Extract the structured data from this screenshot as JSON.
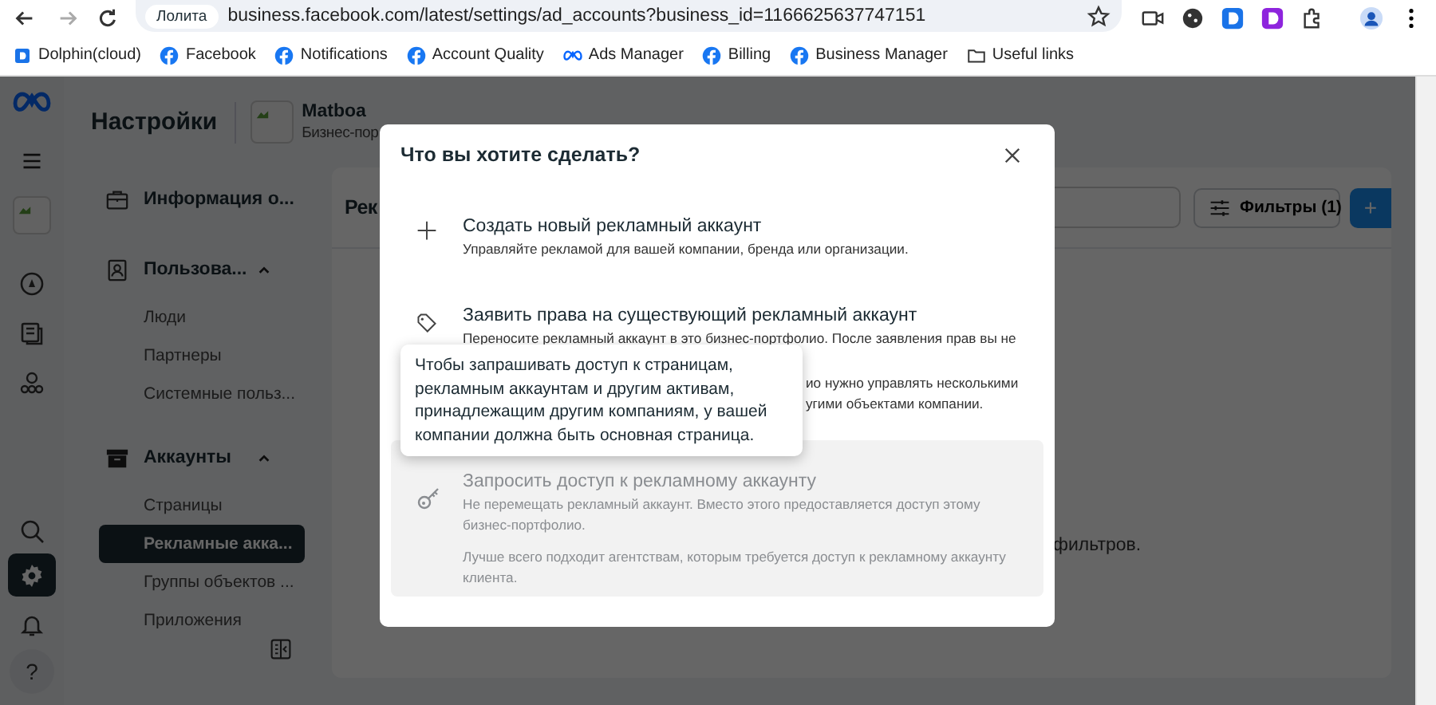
{
  "browser": {
    "site_chip": "Лолита",
    "url": "business.facebook.com/latest/settings/ad_accounts?business_id=1166625637747151",
    "bookmarks": [
      {
        "kind": "dolphin",
        "label": "Dolphin(cloud)"
      },
      {
        "kind": "fb",
        "label": "Facebook"
      },
      {
        "kind": "fb",
        "label": "Notifications"
      },
      {
        "kind": "fb",
        "label": "Account Quality"
      },
      {
        "kind": "meta",
        "label": "Ads Manager"
      },
      {
        "kind": "fb",
        "label": "Billing"
      },
      {
        "kind": "fb",
        "label": "Business Manager"
      },
      {
        "kind": "folder",
        "label": "Useful links"
      }
    ]
  },
  "rail": [
    {
      "kind": "logo",
      "selected": false
    },
    {
      "kind": "menu",
      "selected": false
    },
    {
      "kind": "business",
      "selected": false
    },
    {
      "kind": "compass",
      "selected": false
    },
    {
      "kind": "pages",
      "selected": false
    },
    {
      "kind": "groups",
      "selected": false
    },
    {
      "kind": "search",
      "selected": false
    },
    {
      "kind": "settings",
      "selected": true
    },
    {
      "kind": "bell",
      "selected": false
    },
    {
      "kind": "help",
      "selected": false,
      "label": "?"
    }
  ],
  "header": {
    "title": "Настройки",
    "business_name": "Matboa",
    "business_subtitle": "Бизнес-пор"
  },
  "sidebar": {
    "sections": [
      {
        "kind": "info",
        "label": "Информация о..."
      },
      {
        "kind": "people",
        "label": "Пользова...",
        "expanded": true,
        "children": [
          {
            "label": "Люди",
            "selected": false
          },
          {
            "label": "Партнеры",
            "selected": false
          },
          {
            "label": "Системные польз...",
            "selected": false
          }
        ]
      },
      {
        "kind": "accounts",
        "label": "Аккаунты",
        "expanded": true,
        "children": [
          {
            "label": "Страницы",
            "selected": false
          },
          {
            "label": "Рекламные акка...",
            "selected": true
          },
          {
            "label": "Группы объектов ...",
            "selected": false
          },
          {
            "label": "Приложения",
            "selected": false
          }
        ]
      }
    ]
  },
  "content": {
    "title": "Рек",
    "filter_button": "Фильтры (1)",
    "add_button": "+",
    "empty_text": "фильтров."
  },
  "modal": {
    "title": "Что вы хотите сделать?",
    "options": [
      {
        "kind": "create",
        "title": "Создать новый рекламный аккаунт",
        "description": [
          "Управляйте рекламой для вашей компании, бренда или организации."
        ],
        "disabled": false
      },
      {
        "kind": "claim",
        "title": "Заявить права на существующий рекламный аккаунт",
        "description": [
          "Переносите рекламный аккаунт в это бизнес-портфолио. После заявления прав вы не"
        ],
        "disabled": false
      },
      {
        "kind": "covered",
        "description": [
          "ио нужно управлять несколькими",
          "угими объектами компании."
        ],
        "disabled": false
      },
      {
        "kind": "request",
        "title": "Запросить доступ к рекламному аккаунту",
        "description": [
          "Не перемещать рекламный аккаунт. Вместо этого предоставляется доступ этому бизнес-портфолио.",
          "Лучше всего подходит агентствам, которым требуется доступ к рекламному аккаунту клиента."
        ],
        "disabled": true
      }
    ],
    "tooltip": "Чтобы запрашивать доступ к страницам, рекламным аккаунтам и другим активам, принадлежащим другим компаниям, у вашей компании должна быть основная страница."
  }
}
